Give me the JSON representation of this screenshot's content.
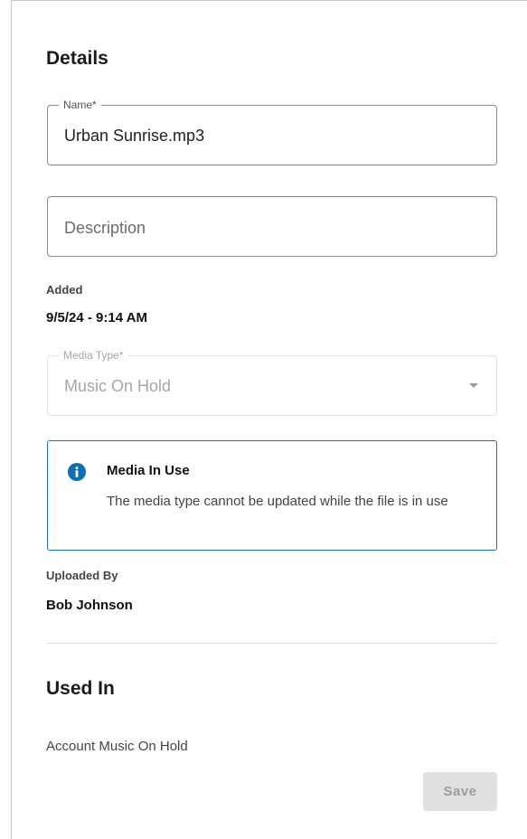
{
  "details": {
    "title": "Details",
    "name_field": {
      "label": "Name*",
      "value": "Urban Sunrise.mp3"
    },
    "description_field": {
      "placeholder": "Description"
    },
    "added": {
      "label": "Added",
      "value": "9/5/24 - 9:14 AM"
    },
    "media_type_field": {
      "label": "Media Type*",
      "value": "Music On Hold",
      "disabled": true
    },
    "info_box": {
      "icon": "info-icon",
      "title": "Media In Use",
      "text": "The media type cannot be updated while the file is in use",
      "accent_color": "#0d6fb8"
    },
    "uploaded_by": {
      "label": "Uploaded By",
      "value": "Bob Johnson"
    }
  },
  "used_in": {
    "title": "Used In",
    "items": [
      "Account Music On Hold"
    ]
  },
  "actions": {
    "save_label": "Save"
  }
}
